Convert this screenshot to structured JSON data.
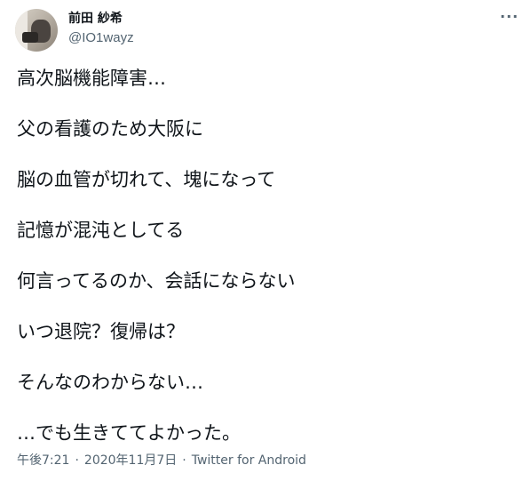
{
  "author": {
    "display_name": "前田 紗希",
    "handle": "@IO1wayz"
  },
  "menu": {
    "more_label": "···"
  },
  "tweet_lines": [
    "高次脳機能障害…",
    "父の看護のため大阪に",
    "脳の血管が切れて、塊になって",
    "記憶が混沌としてる",
    "何言ってるのか、会話にならない",
    "いつ退院？復帰は？",
    "そんなのわからない…",
    "…でも生きててよかった。"
  ],
  "meta": {
    "timestamp": "午後7:21",
    "separator": "·",
    "date": "2020年11月7日",
    "source": "Twitter for Android"
  }
}
